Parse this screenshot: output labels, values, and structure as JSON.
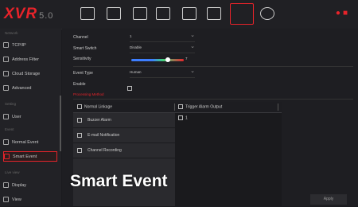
{
  "app": {
    "logo": "XVR",
    "version": "5.0"
  },
  "toolbar": {
    "icons": [
      "playback-icon",
      "video-icon",
      "folder-icon",
      "monitor-icon",
      "camera-icon",
      "hdd-icon",
      "settings-icon",
      "system-icon"
    ],
    "active": "settings-icon",
    "right_icons": [
      "alert-icon",
      "user-icon"
    ]
  },
  "sidebar": {
    "section_network": "Network",
    "items_network": [
      {
        "label": "TCP/IP",
        "icon": "network-icon"
      },
      {
        "label": "Address Filter",
        "icon": "filter-icon"
      },
      {
        "label": "Cloud Storage",
        "icon": "cloud-icon"
      },
      {
        "label": "Advanced",
        "icon": "gear-icon"
      }
    ],
    "section_setting": "Setting",
    "item_user": "User",
    "section_event": "Event",
    "item_normal_event": "Normal Event",
    "item_smart_event": "Smart Event",
    "section_live": "Live view",
    "item_display": "Display",
    "item_view": "View"
  },
  "form": {
    "channel_label": "Channel",
    "channel_value": "1",
    "smart_switch_label": "Smart Switch",
    "smart_switch_value": "Disable",
    "sensitivity_label": "Sensitivity",
    "sensitivity_value": "7",
    "event_type_label": "Event Type",
    "event_type_value": "Human",
    "enable_label": "Enable",
    "processing_tab": "Processing Method"
  },
  "linkage": {
    "normal_header": "Normal Linkage",
    "trigger_header": "Trigger Alarm Output",
    "items": [
      "Buzzer Alarm",
      "E-mail Notification",
      "Channel Recording"
    ],
    "alarm_output": "1"
  },
  "overlay_title": "Smart Event",
  "apply_label": "Apply"
}
